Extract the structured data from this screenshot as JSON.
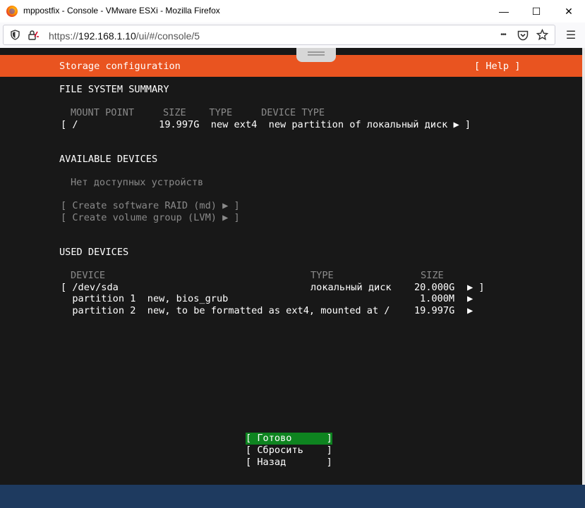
{
  "window": {
    "title": "mppostfix - Console - VMware ESXi - Mozilla Firefox",
    "minimize": "—",
    "maximize": "☐",
    "close": "✕"
  },
  "urlbar": {
    "scheme": "https://",
    "host": "192.168.1.10",
    "path": "/ui/#/console/5",
    "more": "•••",
    "menu": "☰"
  },
  "console": {
    "header": {
      "title": "Storage configuration",
      "help": "[ Help ]"
    },
    "fs_summary": {
      "heading": "FILE SYSTEM SUMMARY",
      "columns": "MOUNT POINT     SIZE    TYPE     DEVICE TYPE",
      "row": "[ /              19.997G  new ext4  new partition of локальный диск ▶ ]"
    },
    "available": {
      "heading": "AVAILABLE DEVICES",
      "empty": "Нет доступных устройств",
      "raid": "[ Create software RAID (md) ▶ ]",
      "lvm": "[ Create volume group (LVM) ▶ ]"
    },
    "used": {
      "heading": "USED DEVICES",
      "col_device": "DEVICE",
      "col_type": "TYPE",
      "col_size": "SIZE",
      "rows": [
        {
          "device": "[ /dev/sda",
          "type": "локальный диск",
          "size": "20.000G",
          "arrow": "▶ ]"
        },
        {
          "device": "  partition 1  new, bios_grub",
          "type": "",
          "size": "1.000M",
          "arrow": "▶"
        },
        {
          "device": "  partition 2  new, to be formatted as ext4, mounted at /",
          "type": "",
          "size": "19.997G",
          "arrow": "▶"
        }
      ]
    },
    "buttons": {
      "done": "[ Готово      ]",
      "reset": "[ Сбросить    ]",
      "back": "[ Назад       ]"
    }
  }
}
